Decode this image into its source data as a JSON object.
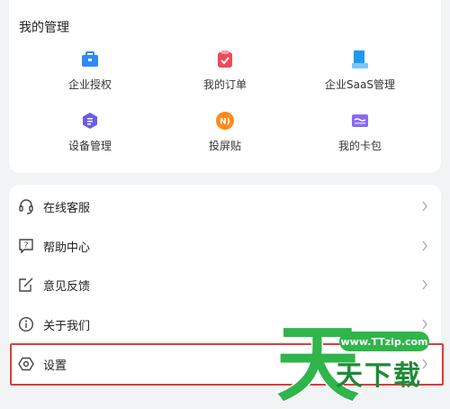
{
  "manage": {
    "title": "我的管理",
    "items": [
      {
        "label": "企业授权",
        "icon": "enterprise-auth-icon",
        "color": "#2f8af5"
      },
      {
        "label": "我的订单",
        "icon": "order-icon",
        "color": "#f04a5a"
      },
      {
        "label": "企业SaaS管理",
        "icon": "saas-icon",
        "color": "#1e9af0"
      },
      {
        "label": "设备管理",
        "icon": "device-icon",
        "color": "#6b5ce7"
      },
      {
        "label": "投屏贴",
        "icon": "cast-sticker-icon",
        "color": "#ff8a1a"
      },
      {
        "label": "我的卡包",
        "icon": "card-wallet-icon",
        "color": "#8a6bf0"
      }
    ]
  },
  "menu": {
    "items": [
      {
        "label": "在线客服",
        "icon": "headset-icon"
      },
      {
        "label": "帮助中心",
        "icon": "help-icon"
      },
      {
        "label": "意见反馈",
        "icon": "feedback-icon"
      },
      {
        "label": "关于我们",
        "icon": "info-icon"
      },
      {
        "label": "设置",
        "icon": "settings-icon"
      }
    ]
  },
  "watermark": {
    "url": "www.TTzip.com",
    "name": "天下载",
    "color": "#2fb54a"
  },
  "highlight_color": "#e23a3a"
}
